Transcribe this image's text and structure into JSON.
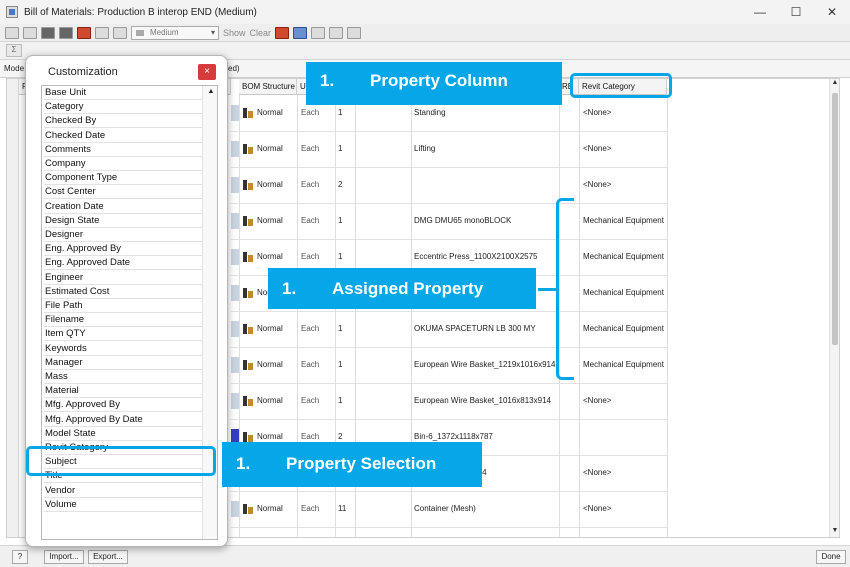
{
  "window": {
    "title": "Bill of Materials: Production B interop END (Medium)"
  },
  "toolbar": {
    "level_select": "Medium",
    "show_label": "Show",
    "clear_label": "Clear",
    "sum_label": "Σ"
  },
  "tabs": {
    "model": "Mode",
    "rest": "ed)"
  },
  "grid": {
    "col_part": "Pa",
    "col_bom": "BOM Structure",
    "col_unit": "Ur",
    "col_re": "RE",
    "col_revit": "Revit Category",
    "rows": [
      {
        "bom": "Normal",
        "unit": "Each",
        "qty": "1",
        "desc": "Standing",
        "revit": "<None>"
      },
      {
        "bom": "Normal",
        "unit": "Each",
        "qty": "1",
        "desc": "Lifting",
        "revit": "<None>"
      },
      {
        "bom": "Normal",
        "unit": "Each",
        "qty": "2",
        "desc": "",
        "revit": "<None>"
      },
      {
        "bom": "Normal",
        "unit": "Each",
        "qty": "1",
        "desc": "DMG DMU65 monoBLOCK",
        "revit": "Mechanical Equipment"
      },
      {
        "bom": "Normal",
        "unit": "Each",
        "qty": "1",
        "desc": "Eccentric Press_1100X2100X2575",
        "revit": "Mechanical Equipment"
      },
      {
        "bom": "Nor",
        "unit": "",
        "qty": "",
        "desc": "",
        "revit": "Mechanical Equipment"
      },
      {
        "bom": "Normal",
        "unit": "Each",
        "qty": "1",
        "desc": "OKUMA SPACETURN LB 300 MY",
        "revit": "Mechanical Equipment"
      },
      {
        "bom": "Normal",
        "unit": "Each",
        "qty": "1",
        "desc": "European Wire Basket_1219x1016x914",
        "revit": "Mechanical Equipment"
      },
      {
        "bom": "Normal",
        "unit": "Each",
        "qty": "1",
        "desc": "European Wire Basket_1016x813x914",
        "revit": "<None>"
      },
      {
        "bom": "Normal",
        "unit": "Each",
        "qty": "2",
        "desc": "Bin-6_1372x1118x787",
        "revit": ""
      },
      {
        "bom": "",
        "unit": "",
        "qty": "",
        "desc": "et_1829x1829x1524",
        "revit": "<None>"
      },
      {
        "bom": "Normal",
        "unit": "Each",
        "qty": "11",
        "desc": "Container (Mesh)",
        "revit": "<None>"
      }
    ]
  },
  "customization": {
    "title": "Customization",
    "close": "×",
    "items": [
      "Base Unit",
      "Category",
      "Checked By",
      "Checked Date",
      "Comments",
      "Company",
      "Component Type",
      "Cost Center",
      "Creation Date",
      "Design State",
      "Designer",
      "Eng. Approved By",
      "Eng. Approved Date",
      "Engineer",
      "Estimated Cost",
      "File Path",
      "Filename",
      "Item QTY",
      "Keywords",
      "Manager",
      "Mass",
      "Material",
      "Mfg. Approved By",
      "Mfg. Approved By Date",
      "Model State",
      "Revit Category",
      "Subject",
      "Title",
      "Vendor",
      "Volume"
    ]
  },
  "statusbar": {
    "import": "Import...",
    "export": "Export...",
    "done": "Done"
  },
  "callouts": {
    "property_column": {
      "num": "1.",
      "label": "Property Column"
    },
    "assigned_property": {
      "num": "1.",
      "label": "Assigned Property"
    },
    "property_selection": {
      "num": "1.",
      "label": "Property Selection"
    }
  },
  "colors": {
    "accent": "#05a7e8",
    "close_red": "#d83b3b"
  }
}
